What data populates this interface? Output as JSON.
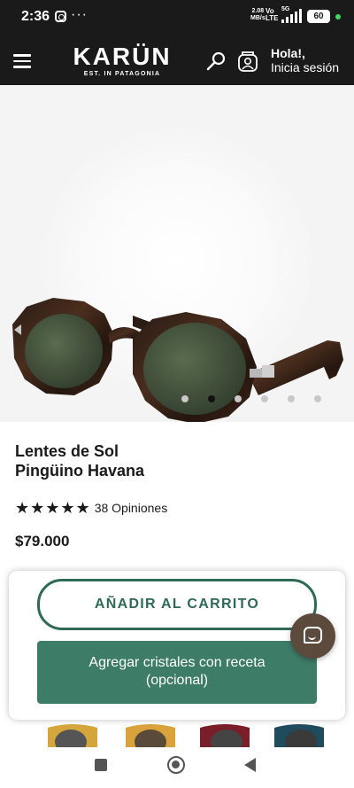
{
  "status_bar": {
    "time": "2:36",
    "more": "···",
    "net_speed": "2.08",
    "net_unit": "MB/s",
    "volte_top": "Vo",
    "volte_bottom": "LTE",
    "network": "5G",
    "battery": "60"
  },
  "header": {
    "brand": "KARÜN",
    "tagline": "EST. IN PATAGONIA",
    "greeting": "Hola!,",
    "login_label": "Inicia sesión"
  },
  "carousel": {
    "slide_count": 6,
    "active_index": 1
  },
  "product": {
    "title_line1": "Lentes de Sol",
    "title_line2": "Pingüino Havana",
    "stars": "★★★★★",
    "rating": 5,
    "reviews": "38 Opiniones",
    "price": "$79.000"
  },
  "actions": {
    "add_to_cart": "AÑADIR AL CARRITO",
    "prescription_line1": "Agregar cristales con receta",
    "prescription_line2": "(opcional)"
  },
  "colors": {
    "header_bg": "#1a1a1a",
    "accent_green": "#2e6a55",
    "button_green": "#3d7c66",
    "chat_brown": "#5c4a3d"
  },
  "icons": {
    "menu": "menu-icon",
    "search": "search-icon",
    "user": "user-icon",
    "chat": "chat-icon"
  }
}
